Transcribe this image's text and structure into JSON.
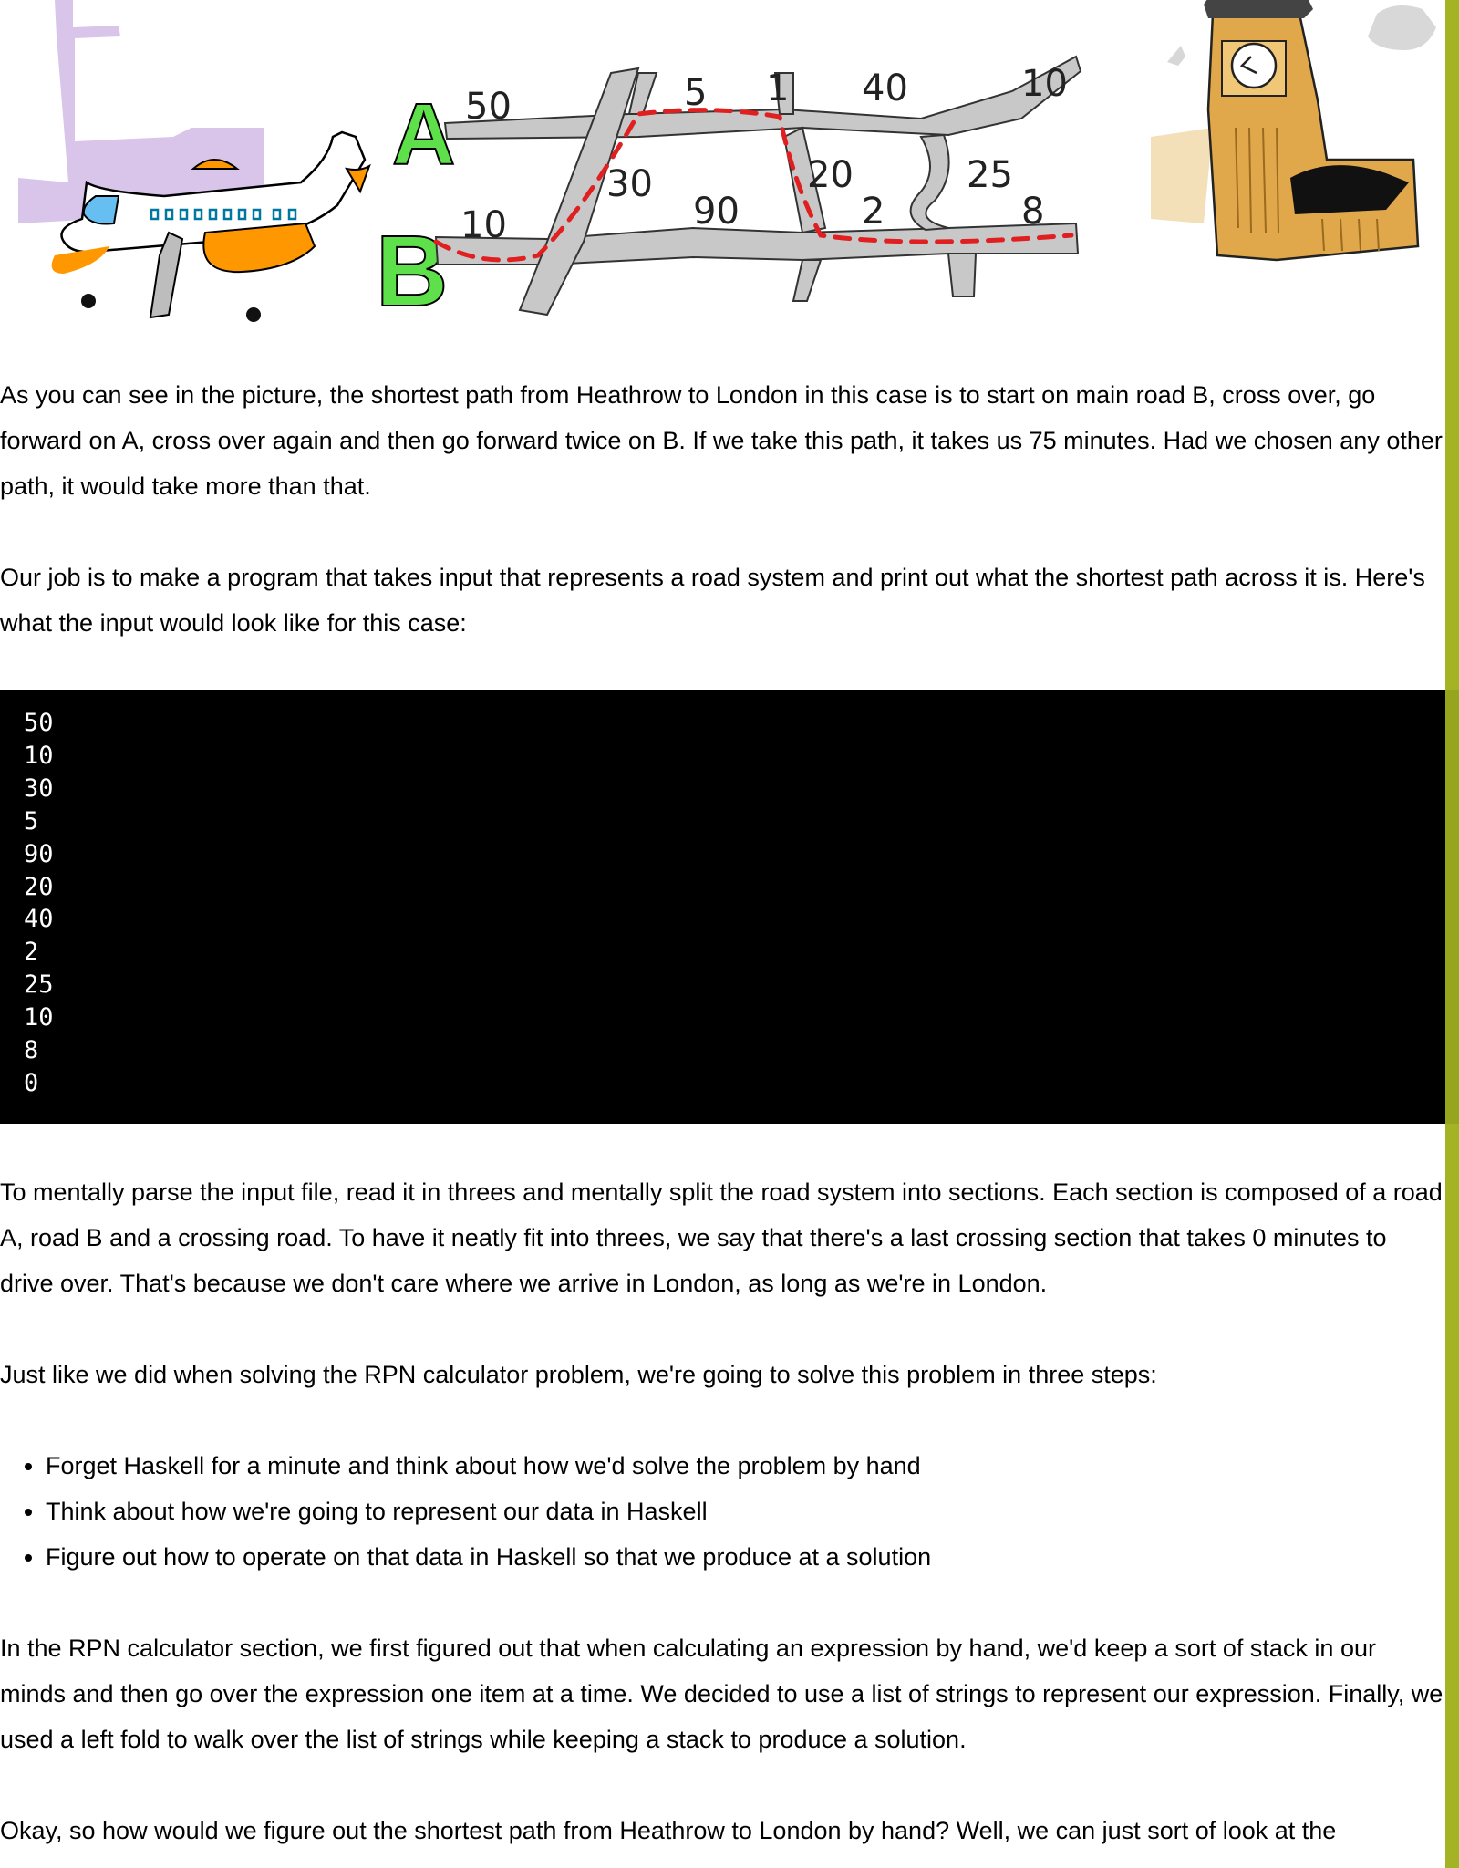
{
  "illustration": {
    "road_labels": [
      "50",
      "5",
      "40",
      "10",
      "30",
      "20",
      "25",
      "90",
      "2",
      "8",
      "10"
    ],
    "main_road_labels": [
      "A",
      "B"
    ]
  },
  "paragraphs": [
    "As you can see in the picture, the shortest path from Heathrow to London in this case is to start on main road B, cross over, go forward on A, cross over again and then go forward twice on B. If we take this path, it takes us 75 minutes. Had we chosen any other path, it would take more than that.",
    "Our job is to make a program that takes input that represents a road system and print out what the shortest path across it is. Here's what the input would look like for this case:",
    "To mentally parse the input file, read it in threes and mentally split the road system into sections. Each section is composed of a road A, road B and a crossing road. To have it neatly fit into threes, we say that there's a last crossing section that takes 0 minutes to drive over. That's because we don't care where we arrive in London, as long as we're in London.",
    "Just like we did when solving the RPN calculator problem, we're going to solve this problem in three steps:",
    "In the RPN calculator section, we first figured out that when calculating an expression by hand, we'd keep a sort of stack in our minds and then go over the expression one item at a time. We decided to use a list of strings to represent our expression. Finally, we used a left fold to walk over the list of strings while keeping a stack to produce a solution.",
    "Okay, so how would we figure out the shortest path from Heathrow to London by hand? Well, we can just sort of look at the"
  ],
  "code_block": "50\n10\n30\n5\n90\n20\n40\n2\n25\n10\n8\n0",
  "steps": [
    "Forget Haskell for a minute and think about how we'd solve the problem by hand",
    "Think about how we're going to represent our data in Haskell",
    "Figure out how to operate on that data in Haskell so that we produce at a solution"
  ],
  "colors": {
    "accent_bar": "#a3b324",
    "code_background": "#000000",
    "route_highlight": "#e02020",
    "road_label_a": "#5ee04a",
    "road_label_b": "#5ee04a"
  }
}
